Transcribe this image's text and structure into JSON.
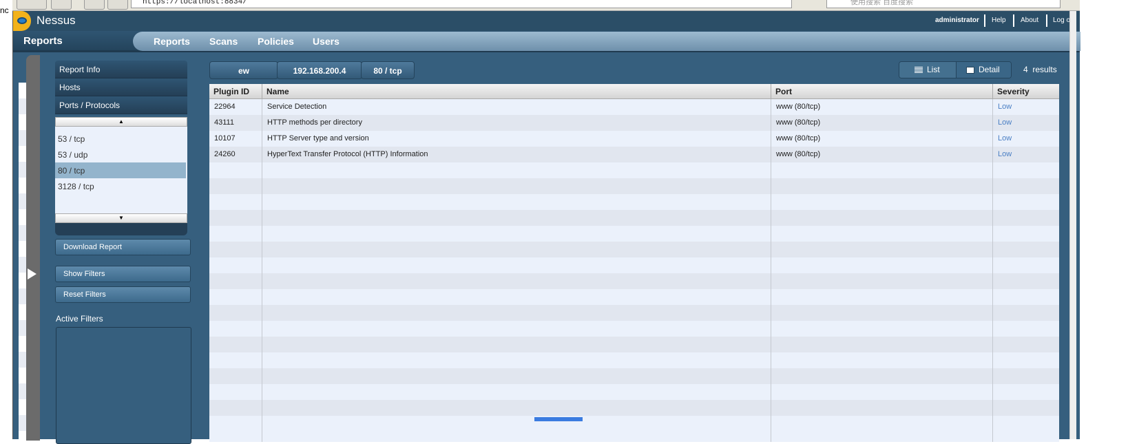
{
  "browser": {
    "url": "https://localhost:8834/",
    "search_placeholder": "使用搜索 百度搜索",
    "left_text": "nc"
  },
  "header": {
    "brand": "Nessus",
    "user": "administrator",
    "links": [
      "Help",
      "About",
      "Log out"
    ]
  },
  "nav": {
    "title": "Reports",
    "items": [
      "Reports",
      "Scans",
      "Policies",
      "Users"
    ]
  },
  "sidebar": {
    "sections": [
      "Report Info",
      "Hosts",
      "Ports / Protocols"
    ],
    "ports": [
      "53 / tcp",
      "53 / udp",
      "80 / tcp",
      "3128 / tcp"
    ],
    "selected_port": "80 / tcp",
    "buttons": {
      "download": "Download Report",
      "show_filters": "Show Filters",
      "reset_filters": "Reset Filters"
    },
    "active_filters_label": "Active Filters"
  },
  "breadcrumb": [
    "ew",
    "192.168.200.4",
    "80 / tcp"
  ],
  "view": {
    "list": "List",
    "detail": "Detail",
    "count": "4",
    "results_label": "results"
  },
  "table": {
    "columns": [
      "Plugin ID",
      "Name",
      "Port",
      "Severity"
    ],
    "rows": [
      {
        "id": "22964",
        "name": "Service Detection",
        "port": "www (80/tcp)",
        "severity": "Low"
      },
      {
        "id": "43111",
        "name": "HTTP methods per directory",
        "port": "www (80/tcp)",
        "severity": "Low"
      },
      {
        "id": "10107",
        "name": "HTTP Server type and version",
        "port": "www (80/tcp)",
        "severity": "Low"
      },
      {
        "id": "24260",
        "name": "HyperText Transfer Protocol (HTTP) Information",
        "port": "www (80/tcp)",
        "severity": "Low"
      }
    ]
  },
  "colors": {
    "severity_low": "#4a7fc4",
    "header_bg": "#2b4e67",
    "panel_bg": "#365f7e"
  }
}
